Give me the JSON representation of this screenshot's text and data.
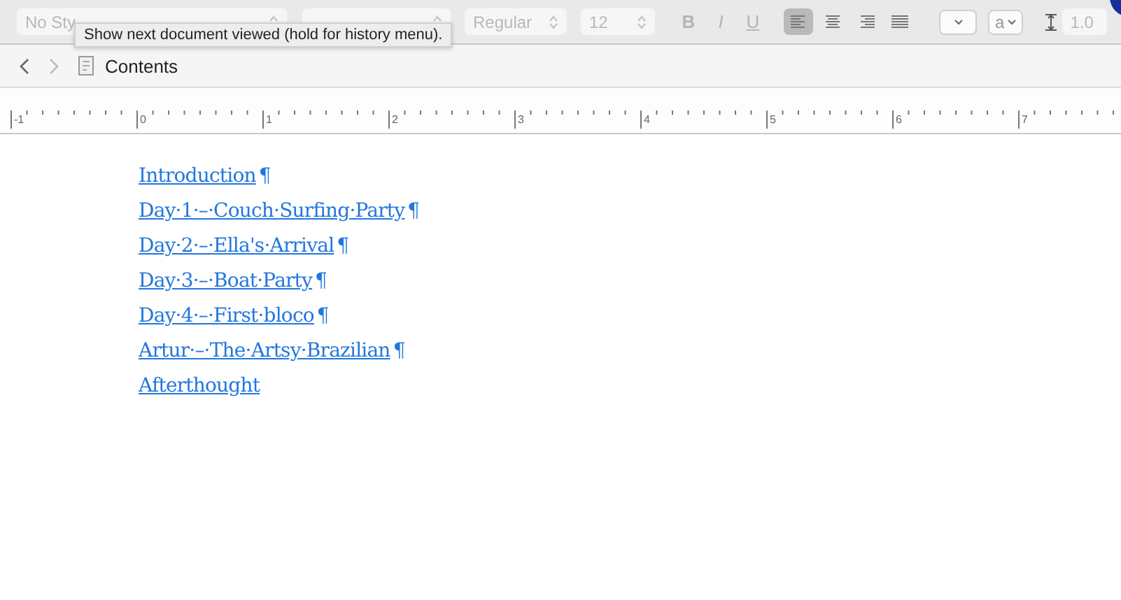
{
  "toolbar": {
    "style_field": "No Sty",
    "weight_field": "Regular",
    "size_field": "12",
    "format_buttons": [
      {
        "label": "B",
        "kind": "bold"
      },
      {
        "label": "I",
        "kind": "italic"
      },
      {
        "label": "U",
        "kind": "underline"
      }
    ],
    "align_buttons": [
      {
        "kind": "left",
        "selected": true
      },
      {
        "kind": "center",
        "selected": false
      },
      {
        "kind": "right",
        "selected": false
      },
      {
        "kind": "justify",
        "selected": false
      }
    ],
    "highlight_dropdown": "a",
    "line_spacing": "1.0"
  },
  "tooltip": "Show next document viewed (hold for history menu).",
  "nav": {
    "title": "Contents"
  },
  "ruler": [
    "-1",
    "0",
    "1",
    "2",
    "3",
    "4",
    "5",
    "6",
    "7"
  ],
  "links": [
    {
      "text": "Introduction",
      "pilcrow": "¶"
    },
    {
      "text": "Day·1·–·Couch·Surfing·Party",
      "pilcrow": "¶"
    },
    {
      "text": "Day·2·–·Ella's·Arrival",
      "pilcrow": "¶"
    },
    {
      "text": "Day·3·–·Boat·Party",
      "pilcrow": "¶"
    },
    {
      "text": "Day·4·–·First·bloco",
      "pilcrow": "¶"
    },
    {
      "text": "Artur·–·The·Artsy·Brazilian",
      "pilcrow": "¶"
    },
    {
      "text": "Afterthought"
    }
  ]
}
